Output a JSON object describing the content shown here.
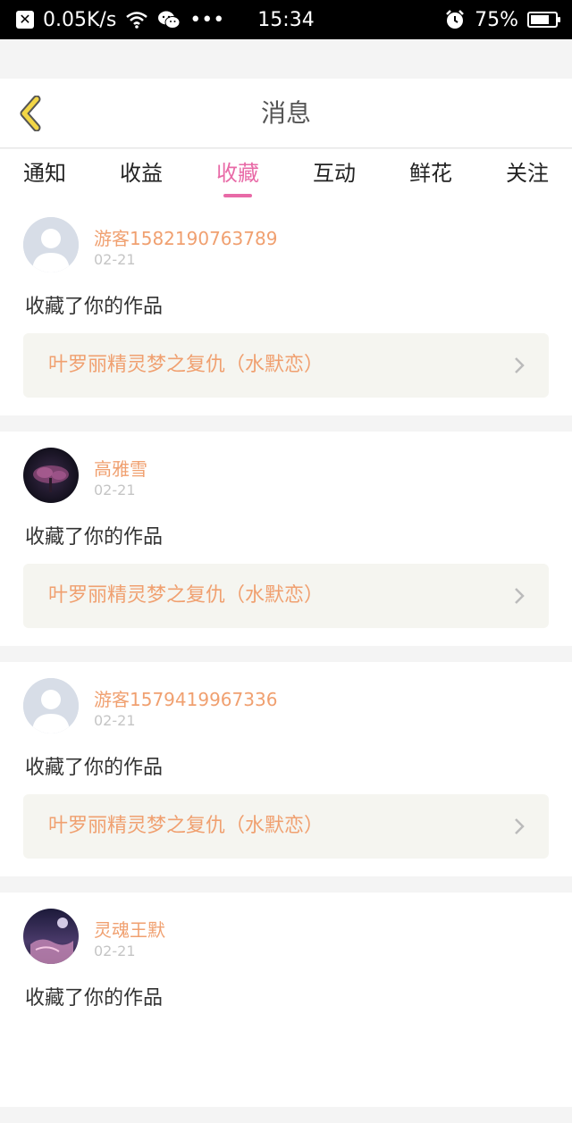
{
  "status_bar": {
    "speed": "0.05K/s",
    "dots": "•••",
    "time": "15:34",
    "battery": "75%",
    "battery_level": 0.75
  },
  "header": {
    "title": "消息",
    "back_icon": "chevron-left-icon"
  },
  "tabs": [
    {
      "label": "通知",
      "active": false
    },
    {
      "label": "收益",
      "active": false
    },
    {
      "label": "收藏",
      "active": true
    },
    {
      "label": "互动",
      "active": false
    },
    {
      "label": "鲜花",
      "active": false
    },
    {
      "label": "关注",
      "active": false
    }
  ],
  "cards": [
    {
      "username": "游客1582190763789",
      "date": "02-21",
      "action": "收藏了你的作品",
      "work": "叶罗丽精灵梦之复仇（水默恋）",
      "avatar": "default-avatar"
    },
    {
      "username": "高雅雪",
      "date": "02-21",
      "action": "收藏了你的作品",
      "work": "叶罗丽精灵梦之复仇（水默恋）",
      "avatar": "photo-avatar-tree"
    },
    {
      "username": "游客1579419967336",
      "date": "02-21",
      "action": "收藏了你的作品",
      "work": "叶罗丽精灵梦之复仇（水默恋）",
      "avatar": "default-avatar"
    },
    {
      "username": "灵魂王默",
      "date": "02-21",
      "action": "收藏了你的作品",
      "work": "",
      "avatar": "photo-avatar-night"
    }
  ],
  "colors": {
    "accent_pink": "#e86aa7",
    "username_orange": "#f0a070",
    "back_yellow": "#f2d646"
  }
}
